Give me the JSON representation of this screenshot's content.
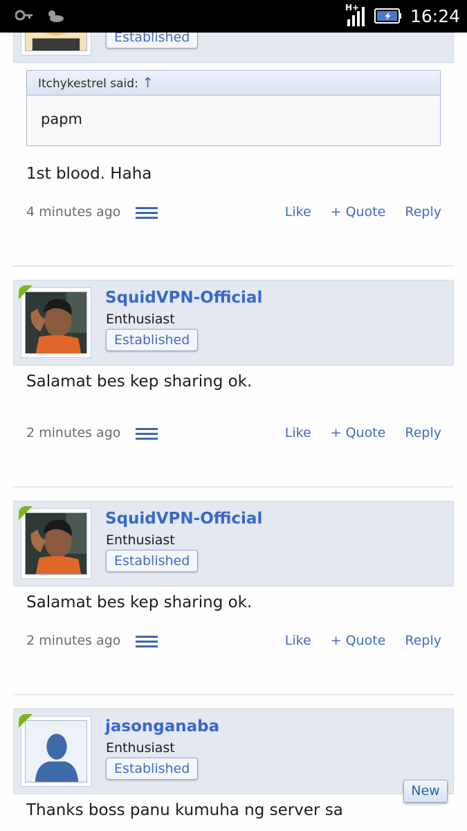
{
  "status_bar": {
    "time": "16:24",
    "network": "H+",
    "icons": [
      "key-icon",
      "weather-icon",
      "signal-icon",
      "battery-icon"
    ]
  },
  "colors": {
    "accent": "#3f6cc5",
    "userbar_bg": "#e3e8f1",
    "online": "#7cb51d"
  },
  "top_partial_post": {
    "badge": "Established",
    "quote": {
      "author_line": "Itchykestrel said:",
      "arrow": "↑",
      "text": "papm"
    },
    "text": "1st blood. Haha",
    "time": "4 minutes ago",
    "actions": {
      "like": "Like",
      "quote": "+ Quote",
      "reply": "Reply"
    }
  },
  "posts": [
    {
      "username": "SquidVPN-Official",
      "title": "Enthusiast",
      "badge": "Established",
      "text": "Salamat bes kep sharing ok.",
      "time": "2 minutes ago",
      "actions": {
        "like": "Like",
        "quote": "+ Quote",
        "reply": "Reply"
      }
    },
    {
      "username": "SquidVPN-Official",
      "title": "Enthusiast",
      "badge": "Established",
      "text": "Salamat bes kep sharing ok.",
      "time": "2 minutes ago",
      "actions": {
        "like": "Like",
        "quote": "+ Quote",
        "reply": "Reply"
      }
    },
    {
      "username": "jasonganaba",
      "title": "Enthusiast",
      "badge": "Established",
      "text": "Thanks boss panu kumuha ng server sa"
    }
  ],
  "new_badge": "New"
}
